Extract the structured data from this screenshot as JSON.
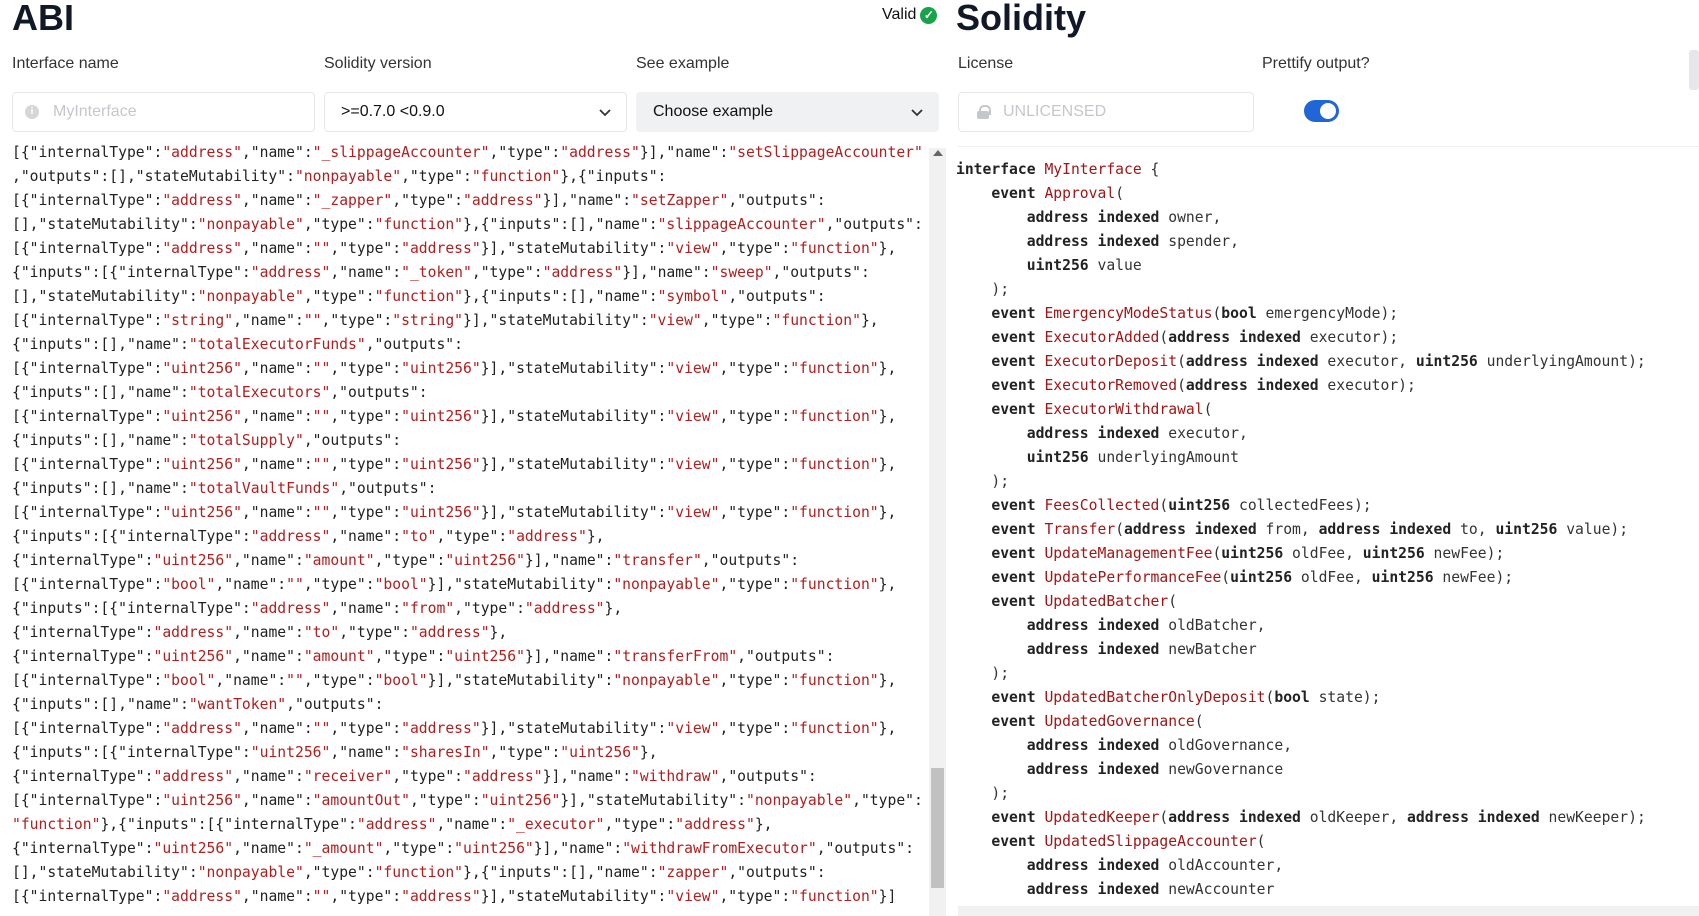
{
  "abi_panel": {
    "title": "ABI",
    "status": "Valid",
    "interface_label": "Interface name",
    "interface_placeholder": "MyInterface",
    "version_label": "Solidity version",
    "version_value": ">=0.7.0 <0.9.0",
    "example_label": "See example",
    "example_value": "Choose example",
    "code_lines": [
      "[{\"internalType\":\"address\",\"name\":\"_slippageAccounter\",\"type\":\"address\"}],\"name\":\"setSlippageAccounter\"",
      ",\"outputs\":[],\"stateMutability\":\"nonpayable\",\"type\":\"function\"},{\"inputs\":",
      "[{\"internalType\":\"address\",\"name\":\"_zapper\",\"type\":\"address\"}],\"name\":\"setZapper\",\"outputs\":",
      "[],\"stateMutability\":\"nonpayable\",\"type\":\"function\"},{\"inputs\":[],\"name\":\"slippageAccounter\",\"outputs\":",
      "[{\"internalType\":\"address\",\"name\":\"\",\"type\":\"address\"}],\"stateMutability\":\"view\",\"type\":\"function\"},",
      "{\"inputs\":[{\"internalType\":\"address\",\"name\":\"_token\",\"type\":\"address\"}],\"name\":\"sweep\",\"outputs\":",
      "[],\"stateMutability\":\"nonpayable\",\"type\":\"function\"},{\"inputs\":[],\"name\":\"symbol\",\"outputs\":",
      "[{\"internalType\":\"string\",\"name\":\"\",\"type\":\"string\"}],\"stateMutability\":\"view\",\"type\":\"function\"},",
      "{\"inputs\":[],\"name\":\"totalExecutorFunds\",\"outputs\":",
      "[{\"internalType\":\"uint256\",\"name\":\"\",\"type\":\"uint256\"}],\"stateMutability\":\"view\",\"type\":\"function\"},",
      "{\"inputs\":[],\"name\":\"totalExecutors\",\"outputs\":",
      "[{\"internalType\":\"uint256\",\"name\":\"\",\"type\":\"uint256\"}],\"stateMutability\":\"view\",\"type\":\"function\"},",
      "{\"inputs\":[],\"name\":\"totalSupply\",\"outputs\":",
      "[{\"internalType\":\"uint256\",\"name\":\"\",\"type\":\"uint256\"}],\"stateMutability\":\"view\",\"type\":\"function\"},",
      "{\"inputs\":[],\"name\":\"totalVaultFunds\",\"outputs\":",
      "[{\"internalType\":\"uint256\",\"name\":\"\",\"type\":\"uint256\"}],\"stateMutability\":\"view\",\"type\":\"function\"},",
      "{\"inputs\":[{\"internalType\":\"address\",\"name\":\"to\",\"type\":\"address\"},",
      "{\"internalType\":\"uint256\",\"name\":\"amount\",\"type\":\"uint256\"}],\"name\":\"transfer\",\"outputs\":",
      "[{\"internalType\":\"bool\",\"name\":\"\",\"type\":\"bool\"}],\"stateMutability\":\"nonpayable\",\"type\":\"function\"},",
      "{\"inputs\":[{\"internalType\":\"address\",\"name\":\"from\",\"type\":\"address\"},",
      "{\"internalType\":\"address\",\"name\":\"to\",\"type\":\"address\"},",
      "{\"internalType\":\"uint256\",\"name\":\"amount\",\"type\":\"uint256\"}],\"name\":\"transferFrom\",\"outputs\":",
      "[{\"internalType\":\"bool\",\"name\":\"\",\"type\":\"bool\"}],\"stateMutability\":\"nonpayable\",\"type\":\"function\"},",
      "{\"inputs\":[],\"name\":\"wantToken\",\"outputs\":",
      "[{\"internalType\":\"address\",\"name\":\"\",\"type\":\"address\"}],\"stateMutability\":\"view\",\"type\":\"function\"},",
      "{\"inputs\":[{\"internalType\":\"uint256\",\"name\":\"sharesIn\",\"type\":\"uint256\"},",
      "{\"internalType\":\"address\",\"name\":\"receiver\",\"type\":\"address\"}],\"name\":\"withdraw\",\"outputs\":",
      "[{\"internalType\":\"uint256\",\"name\":\"amountOut\",\"type\":\"uint256\"}],\"stateMutability\":\"nonpayable\",\"type\":",
      "\"function\"},{\"inputs\":[{\"internalType\":\"address\",\"name\":\"_executor\",\"type\":\"address\"},",
      "{\"internalType\":\"uint256\",\"name\":\"_amount\",\"type\":\"uint256\"}],\"name\":\"withdrawFromExecutor\",\"outputs\":",
      "[],\"stateMutability\":\"nonpayable\",\"type\":\"function\"},{\"inputs\":[],\"name\":\"zapper\",\"outputs\":",
      "[{\"internalType\":\"address\",\"name\":\"\",\"type\":\"address\"}],\"stateMutability\":\"view\",\"type\":\"function\"}]"
    ]
  },
  "solidity_panel": {
    "title": "Solidity",
    "license_label": "License",
    "license_placeholder": "UNLICENSED",
    "prettify_label": "Prettify output?",
    "prettify_on": true,
    "code_lines": [
      "interface MyInterface {",
      "    event Approval(",
      "        address indexed owner,",
      "        address indexed spender,",
      "        uint256 value",
      "    );",
      "    event EmergencyModeStatus(bool emergencyMode);",
      "    event ExecutorAdded(address indexed executor);",
      "    event ExecutorDeposit(address indexed executor, uint256 underlyingAmount);",
      "    event ExecutorRemoved(address indexed executor);",
      "    event ExecutorWithdrawal(",
      "        address indexed executor,",
      "        uint256 underlyingAmount",
      "    );",
      "    event FeesCollected(uint256 collectedFees);",
      "    event Transfer(address indexed from, address indexed to, uint256 value);",
      "    event UpdateManagementFee(uint256 oldFee, uint256 newFee);",
      "    event UpdatePerformanceFee(uint256 oldFee, uint256 newFee);",
      "    event UpdatedBatcher(",
      "        address indexed oldBatcher,",
      "        address indexed newBatcher",
      "    );",
      "    event UpdatedBatcherOnlyDeposit(bool state);",
      "    event UpdatedGovernance(",
      "        address indexed oldGovernance,",
      "        address indexed newGovernance",
      "    );",
      "    event UpdatedKeeper(address indexed oldKeeper, address indexed newKeeper);",
      "    event UpdatedSlippageAccounter(",
      "        address indexed oldAccounter,",
      "        address indexed newAccounter"
    ]
  },
  "colors": {
    "accent": "#2166d6",
    "string": "#b31d1d",
    "identifier": "#a31515",
    "valid": "#16a34a"
  }
}
